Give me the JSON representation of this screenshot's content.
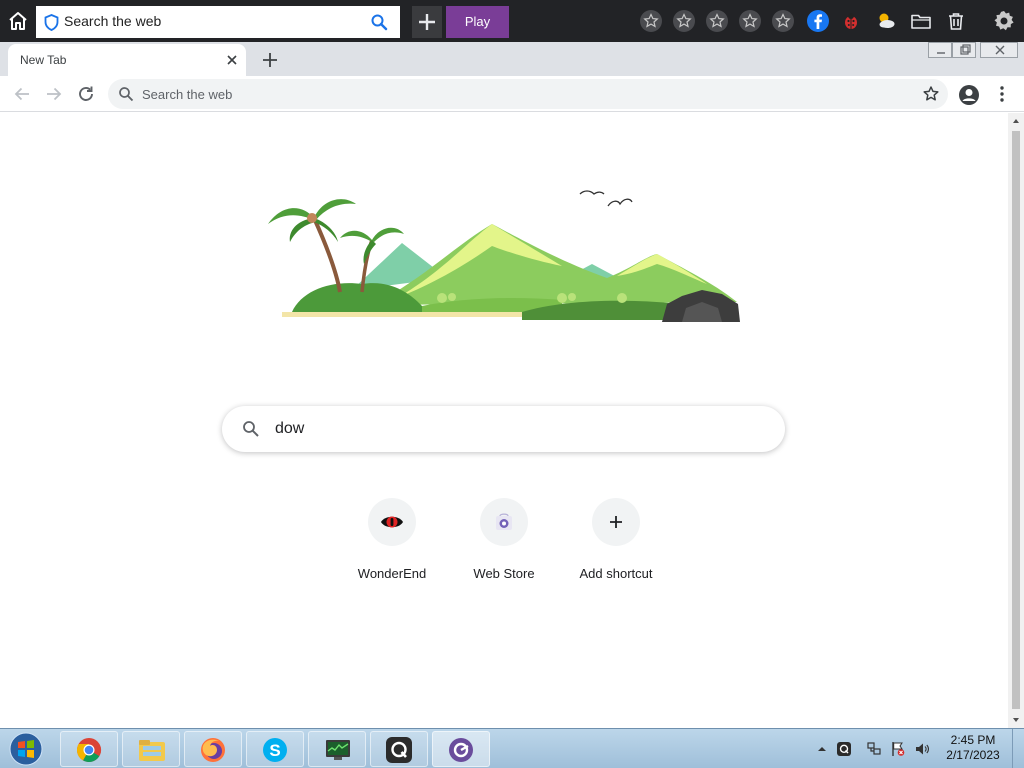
{
  "extension_bar": {
    "search_placeholder": "Search the web",
    "play_label": "Play",
    "accent": "#7a3d97",
    "icons": [
      "home-icon",
      "shield-icon",
      "search-icon",
      "plus-icon",
      "star-icon",
      "star-icon",
      "star-icon",
      "star-icon",
      "star-icon",
      "facebook-icon",
      "ladybug-icon",
      "weather-icon",
      "folder-icon",
      "trash-icon",
      "gear-icon"
    ]
  },
  "tab": {
    "title": "New Tab"
  },
  "omnibox": {
    "placeholder": "Search the web"
  },
  "ntp": {
    "search_value": "dow",
    "shortcuts": [
      {
        "label": "WonderEnd",
        "icon": "wonderend-icon"
      },
      {
        "label": "Web Store",
        "icon": "web-store-icon"
      },
      {
        "label": "Add shortcut",
        "icon": "plus-icon"
      }
    ]
  },
  "taskbar": {
    "apps": [
      "chrome-icon",
      "file-explorer-icon",
      "firefox-icon",
      "skype-icon",
      "task-manager-icon",
      "q-app-icon",
      "browser-app-icon"
    ],
    "clock_time": "2:45 PM",
    "clock_date": "2/17/2023"
  }
}
